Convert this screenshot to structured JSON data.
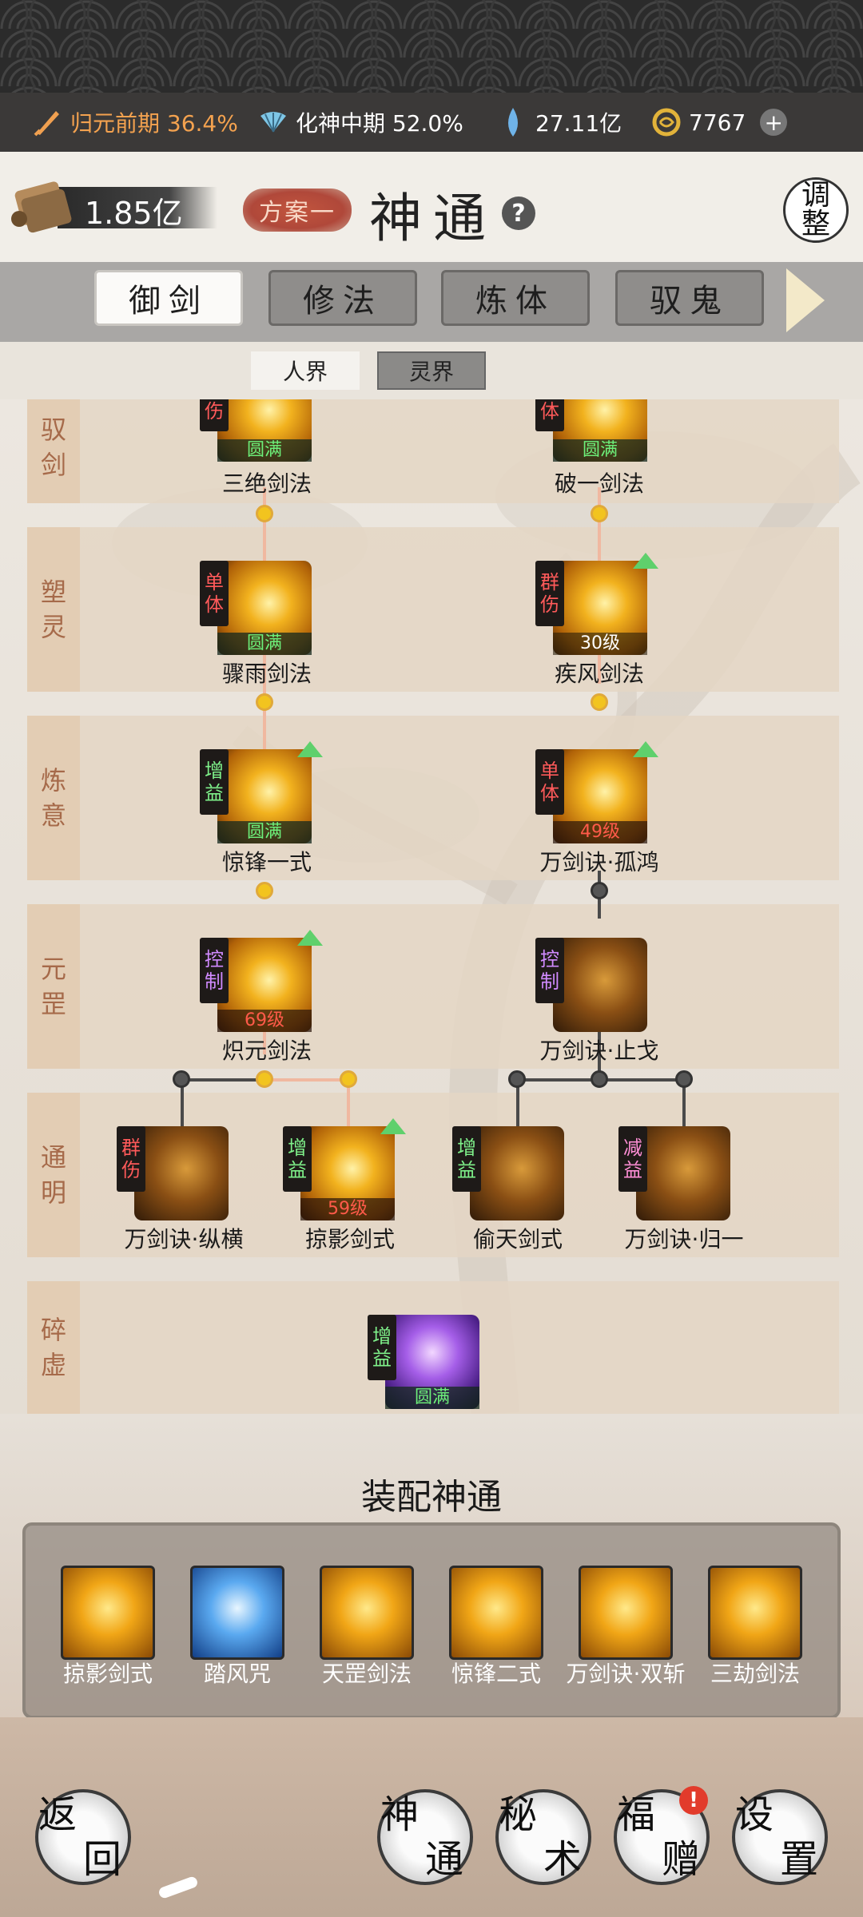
{
  "resources": {
    "cultivation_realm": "归元前期 36.4%",
    "spirit_realm": "化神中期 52.0%",
    "spirit_stones": "27.11亿",
    "currency": "7767"
  },
  "header": {
    "scroll_value": "1.85亿",
    "plan_label": "方案一",
    "title": "神通",
    "help_label": "?",
    "adjust_label_1": "调",
    "adjust_label_2": "整"
  },
  "tabs": [
    "御剑",
    "修法",
    "炼体",
    "驭鬼"
  ],
  "realm_tabs": [
    "人界",
    "灵界"
  ],
  "rows": {
    "r1": [
      "驭",
      "剑"
    ],
    "r2": [
      "塑",
      "灵"
    ],
    "r3": [
      "炼",
      "意"
    ],
    "r4": [
      "元",
      "罡"
    ],
    "r5": [
      "通",
      "明"
    ],
    "r6": [
      "碎",
      "虚"
    ]
  },
  "skills": {
    "s1": {
      "name": "三绝剑法",
      "tag": "伤",
      "status": "圆满"
    },
    "s2": {
      "name": "破一剑法",
      "tag": "体",
      "status": "圆满"
    },
    "s3": {
      "name": "骤雨剑法",
      "tag1": "单",
      "tag2": "体",
      "status": "圆满"
    },
    "s4": {
      "name": "疾风剑法",
      "tag1": "群",
      "tag2": "伤",
      "status": "30级"
    },
    "s5": {
      "name": "惊锋一式",
      "tag1": "增",
      "tag2": "益",
      "status": "圆满"
    },
    "s6": {
      "name": "万剑诀·孤鸿",
      "tag1": "单",
      "tag2": "体",
      "status": "49级"
    },
    "s7": {
      "name": "炽元剑法",
      "tag1": "控",
      "tag2": "制",
      "status": "69级"
    },
    "s8": {
      "name": "万剑诀·止戈",
      "tag1": "控",
      "tag2": "制",
      "status": ""
    },
    "s9": {
      "name": "万剑诀·纵横",
      "tag1": "群",
      "tag2": "伤",
      "status": ""
    },
    "s10": {
      "name": "掠影剑式",
      "tag1": "增",
      "tag2": "益",
      "status": "59级"
    },
    "s11": {
      "name": "偷天剑式",
      "tag1": "增",
      "tag2": "益",
      "status": ""
    },
    "s12": {
      "name": "万剑诀·归一",
      "tag1": "减",
      "tag2": "益",
      "status": ""
    },
    "s13": {
      "tag1": "增",
      "tag2": "益",
      "status": "圆满"
    }
  },
  "equipped": {
    "title": "装配神通",
    "items": [
      "掠影剑式",
      "踏风咒",
      "天罡剑法",
      "惊锋二式",
      "万剑诀·双斩",
      "三劫剑法"
    ]
  },
  "bottom_nav": {
    "back": [
      "返",
      "回"
    ],
    "skills": [
      "神",
      "通"
    ],
    "secret": [
      "秘",
      "术"
    ],
    "gift": [
      "福",
      "赠"
    ],
    "settings": [
      "设",
      "置"
    ],
    "alert": "!"
  }
}
